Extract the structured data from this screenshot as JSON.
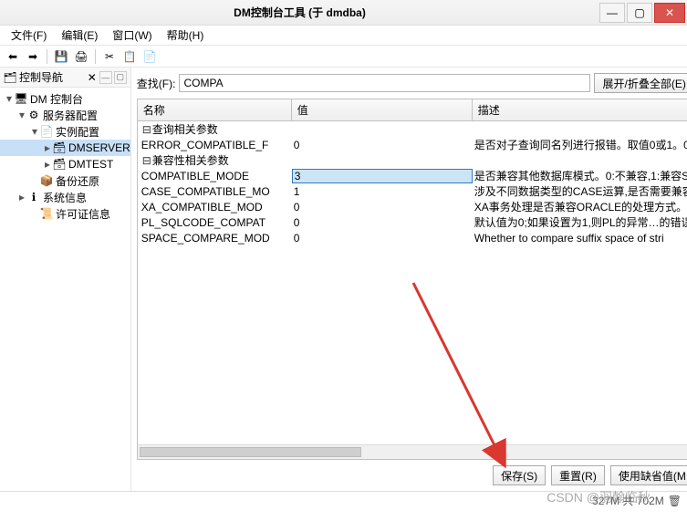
{
  "window": {
    "title": "DM控制台工具 (于 dmdba)"
  },
  "menu": {
    "file": "文件(F)",
    "edit": "编辑(E)",
    "window": "窗口(W)",
    "help": "帮助(H)"
  },
  "nav": {
    "title": "控制导航",
    "root": "DM 控制台",
    "server_config": "服务器配置",
    "instance_config": "实例配置",
    "dmserver": "DMSERVER",
    "dmtest": "DMTEST",
    "backup_restore": "备份还原",
    "system_info": "系统信息",
    "license_info": "许可证信息"
  },
  "search": {
    "label": "查找(F):",
    "value": "COMPA",
    "expand_btn": "展开/折叠全部(E)"
  },
  "columns": {
    "name": "名称",
    "value": "值",
    "desc": "描述"
  },
  "groups": [
    {
      "title": "查询相关参数",
      "rows": [
        {
          "name": "ERROR_COMPATIBLE_F",
          "value": "0",
          "desc": "是否对子查询同名列进行报错。取值0或1。0"
        }
      ]
    },
    {
      "title": "兼容性相关参数",
      "rows": [
        {
          "name": "COMPATIBLE_MODE",
          "value": "3",
          "desc": "是否兼容其他数据库模式。0:不兼容,1:兼容S",
          "editing": true
        },
        {
          "name": "CASE_COMPATIBLE_MO",
          "value": "1",
          "desc": "涉及不同数据类型的CASE运算,是否需要兼容"
        },
        {
          "name": "XA_COMPATIBLE_MOD",
          "value": "0",
          "desc": "XA事务处理是否兼容ORACLE的处理方式。0"
        },
        {
          "name": "PL_SQLCODE_COMPAT",
          "value": "0",
          "desc": "默认值为0;如果设置为1,则PL的异常…的错误"
        },
        {
          "name": "SPACE_COMPARE_MOD",
          "value": "0",
          "desc": "Whether to compare suffix space of stri"
        }
      ]
    }
  ],
  "buttons": {
    "save": "保存(S)",
    "reset": "重置(R)",
    "defaults": "使用缺省值(M"
  },
  "status": {
    "memory": "327M 共 702M"
  },
  "watermark": "CSDN @羽翰临秋"
}
